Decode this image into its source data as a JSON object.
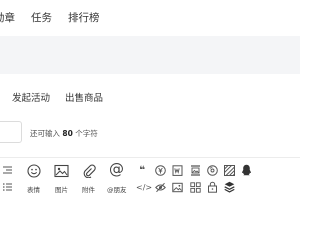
{
  "nav": {
    "items": [
      "勋章",
      "任务",
      "排行榜"
    ]
  },
  "tabs": {
    "items": [
      "发起活动",
      "出售商品"
    ]
  },
  "title_field": {
    "value": "",
    "hint_prefix": "还可输入",
    "remaining": "80",
    "hint_suffix": "个字符"
  },
  "toolbar": {
    "emoji_label": "表情",
    "image_label": "图片",
    "attachment_label": "附件",
    "mention_label": "@朋友",
    "mention_glyph": "@",
    "quote_glyph": "❝",
    "code_glyph": "</>"
  },
  "colors": {
    "band": "#f4f5f7",
    "text": "#333333",
    "icon": "#555555",
    "border": "#dcdcdc"
  }
}
